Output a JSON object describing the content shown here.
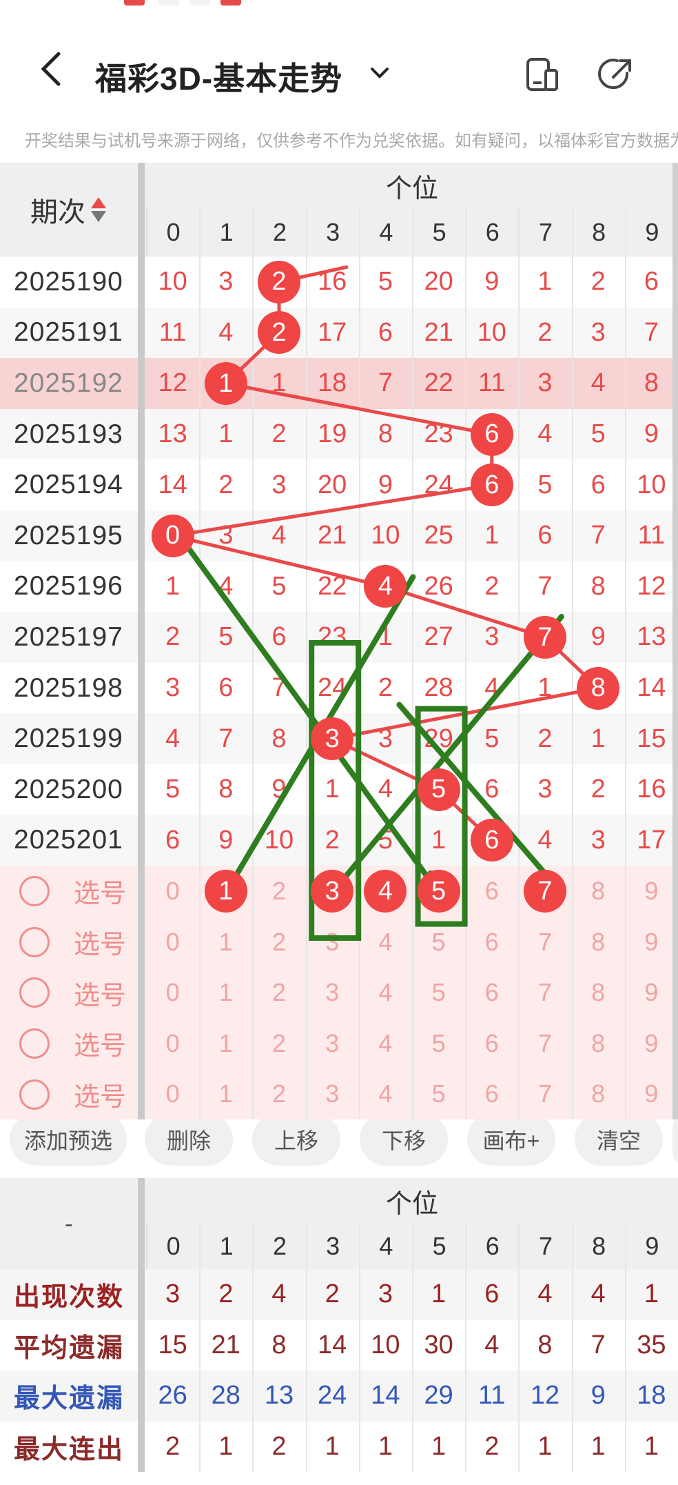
{
  "colors": {
    "red": "#e84a4a",
    "ball": "#f04545",
    "green": "#2e7d1e",
    "dark_red": "#9c2121",
    "blue": "#3457b7",
    "highlight": "#f7d3d3"
  },
  "header": {
    "title": "福彩3D-基本走势",
    "back_icon": "chevron-left-icon",
    "dropdown_icon": "chevron-down-icon",
    "icon_a": "phone-share-icon",
    "icon_b": "share-arrow-icon"
  },
  "notice": "开奖结果与试机号来源于网络，仅供参考不作为兑奖依据。如有疑问，以福体彩官方数据为准",
  "table": {
    "period_header": "期次",
    "sort_icon": "sort-arrows-icon",
    "group_header": "个位",
    "digits": [
      "0",
      "1",
      "2",
      "3",
      "4",
      "5",
      "6",
      "7",
      "8",
      "9"
    ],
    "rows": [
      {
        "period": "2025190",
        "cells": [
          "10",
          "3",
          "2",
          "16",
          "5",
          "20",
          "9",
          "1",
          "2",
          "6"
        ],
        "hit": 2
      },
      {
        "period": "2025191",
        "cells": [
          "11",
          "4",
          "2",
          "17",
          "6",
          "21",
          "10",
          "2",
          "3",
          "7"
        ],
        "hit": 2
      },
      {
        "period": "2025192",
        "cells": [
          "12",
          "1",
          "1",
          "18",
          "7",
          "22",
          "11",
          "3",
          "4",
          "8"
        ],
        "hit": 1
      },
      {
        "period": "2025193",
        "cells": [
          "13",
          "1",
          "2",
          "19",
          "8",
          "23",
          "6",
          "4",
          "5",
          "9"
        ],
        "hit": 6
      },
      {
        "period": "2025194",
        "cells": [
          "14",
          "2",
          "3",
          "20",
          "9",
          "24",
          "6",
          "5",
          "6",
          "10"
        ],
        "hit": 6
      },
      {
        "period": "2025195",
        "cells": [
          "0",
          "3",
          "4",
          "21",
          "10",
          "25",
          "1",
          "6",
          "7",
          "11"
        ],
        "hit": 0
      },
      {
        "period": "2025196",
        "cells": [
          "1",
          "4",
          "5",
          "22",
          "4",
          "26",
          "2",
          "7",
          "8",
          "12"
        ],
        "hit": 4
      },
      {
        "period": "2025197",
        "cells": [
          "2",
          "5",
          "6",
          "23",
          "1",
          "27",
          "3",
          "7",
          "9",
          "13"
        ],
        "hit": 7
      },
      {
        "period": "2025198",
        "cells": [
          "3",
          "6",
          "7",
          "24",
          "2",
          "28",
          "4",
          "1",
          "8",
          "14"
        ],
        "hit": 8
      },
      {
        "period": "2025199",
        "cells": [
          "4",
          "7",
          "8",
          "3",
          "3",
          "29",
          "5",
          "2",
          "1",
          "15"
        ],
        "hit": 3
      },
      {
        "period": "2025200",
        "cells": [
          "5",
          "8",
          "9",
          "1",
          "4",
          "5",
          "6",
          "3",
          "2",
          "16"
        ],
        "hit": 5
      },
      {
        "period": "2025201",
        "cells": [
          "6",
          "9",
          "10",
          "2",
          "5",
          "1",
          "6",
          "4",
          "3",
          "17"
        ],
        "hit": 6
      }
    ],
    "choose_label": "选号",
    "choose_rows": [
      {
        "selected": [
          1,
          3,
          4,
          5,
          7
        ]
      },
      {
        "selected": []
      },
      {
        "selected": []
      },
      {
        "selected": []
      },
      {
        "selected": []
      }
    ]
  },
  "toolbar": [
    "添加预选",
    "删除",
    "上移",
    "下移",
    "画布+",
    "清空"
  ],
  "stats": {
    "corner": "-",
    "group_header": "个位",
    "rows": [
      {
        "label": "出现次数",
        "color": "#9c2121",
        "values": [
          "3",
          "2",
          "4",
          "2",
          "3",
          "1",
          "6",
          "4",
          "4",
          "1"
        ]
      },
      {
        "label": "平均遗漏",
        "color": "#8c2a2a",
        "values": [
          "15",
          "21",
          "8",
          "14",
          "10",
          "30",
          "4",
          "8",
          "7",
          "35"
        ]
      },
      {
        "label": "最大遗漏",
        "color": "#3457b7",
        "values": [
          "26",
          "28",
          "13",
          "24",
          "14",
          "29",
          "11",
          "12",
          "9",
          "18"
        ]
      },
      {
        "label": "最大连出",
        "color": "#8c2a2a",
        "values": [
          "2",
          "1",
          "2",
          "1",
          "1",
          "1",
          "2",
          "1",
          "1",
          "1"
        ]
      }
    ]
  }
}
